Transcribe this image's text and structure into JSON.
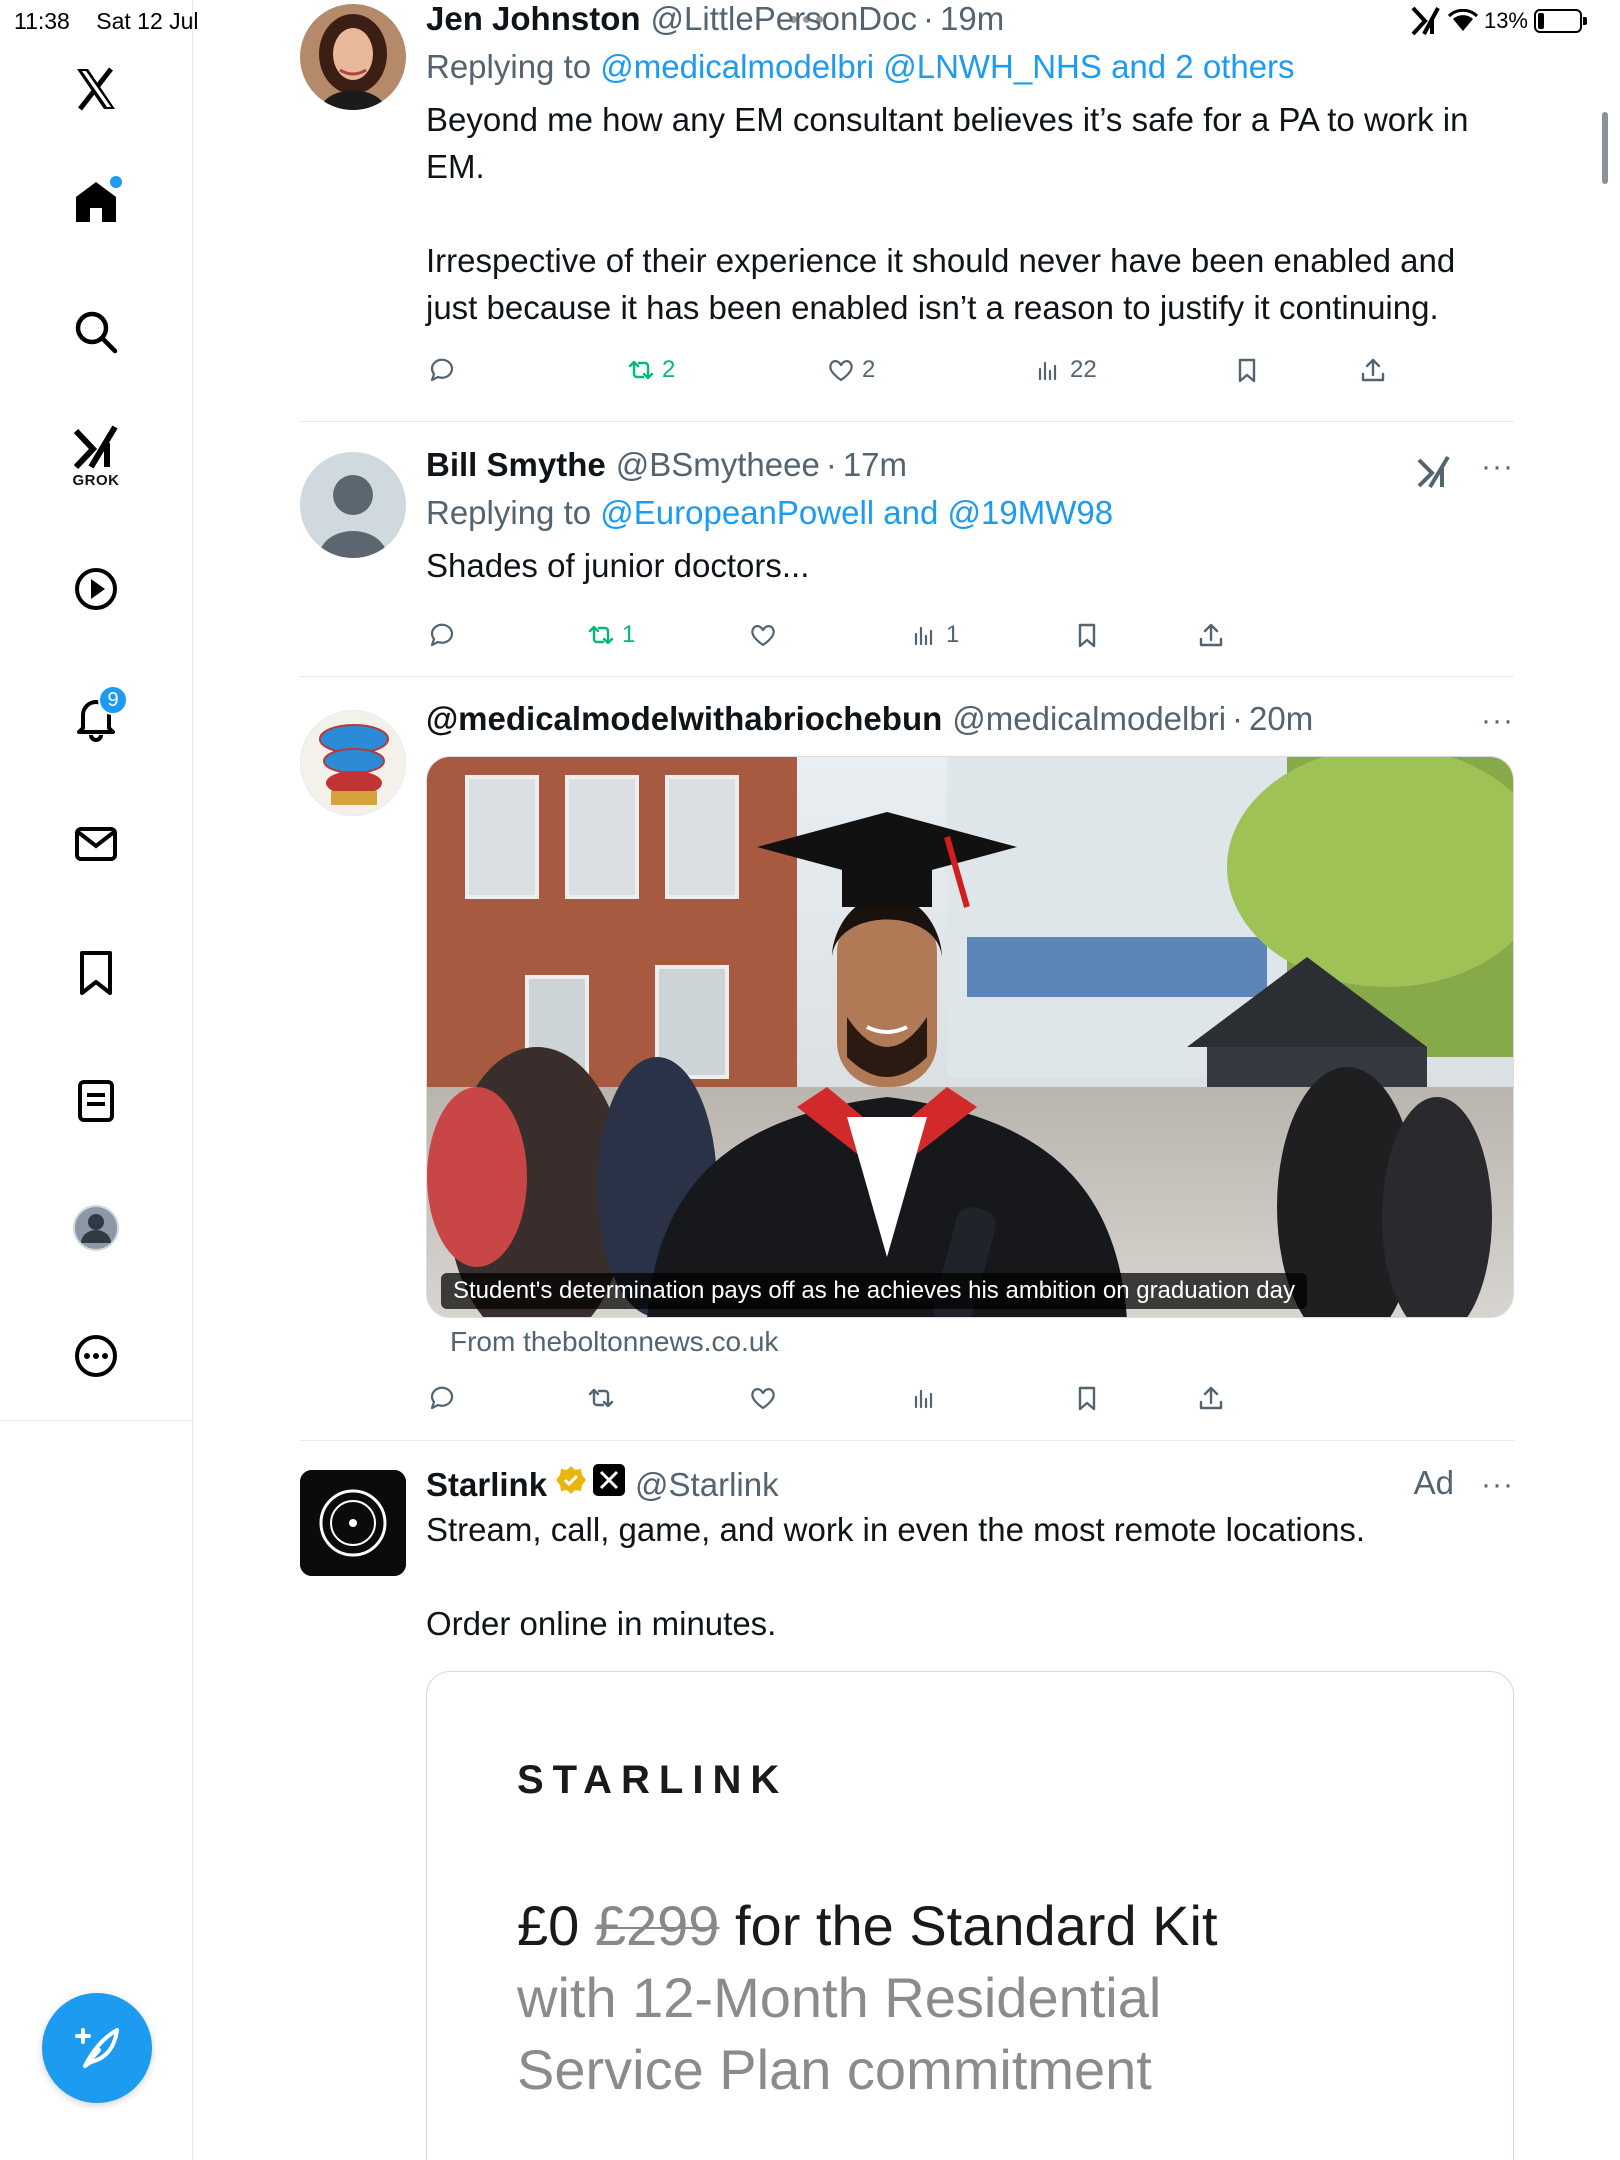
{
  "status_bar": {
    "time": "11:38",
    "date": "Sat 12 Jul",
    "battery_percent": "13%"
  },
  "sidebar": {
    "grok_label": "GROK",
    "notifications_badge": "9"
  },
  "colors": {
    "accent": "#1d9bf0",
    "retweet_green": "#00ba7c",
    "muted_text": "#536471"
  },
  "tweets": [
    {
      "name": "Jen Johnston",
      "handle": "@LittlePersonDoc",
      "time": "19m",
      "reply_prefix": "Replying to",
      "reply_targets": "@medicalmodelbri @LNWH_NHS and 2 others",
      "paragraphs": [
        "Beyond me how any EM consultant believes it’s safe for a PA to work in EM.",
        "Irrespective of their experience it should never have been enabled and just because it has been enabled isn’t a reason to justify it continuing."
      ],
      "retweets": "2",
      "likes": "2",
      "views": "22"
    },
    {
      "name": "Bill Smythe",
      "handle": "@BSmytheee",
      "time": "17m",
      "reply_prefix": "Replying to",
      "reply_targets": "@EuropeanPowell and @19MW98",
      "text": "Shades of junior doctors...",
      "retweets": "1",
      "views": "1"
    },
    {
      "name": "@medicalmodelwithabriochebun",
      "handle": "@medicalmodelbri",
      "time": "20m",
      "media_caption": "Student's determination pays off as he achieves his ambition on graduation day",
      "source": "From theboltonnews.co.uk"
    },
    {
      "name": "Starlink",
      "handle": "@Starlink",
      "ad_label": "Ad",
      "paragraphs": [
        "Stream, call, game, and work in even the most remote locations.",
        "Order online in minutes."
      ],
      "card": {
        "logo": "STARLINK",
        "price_new": "£0",
        "price_old": "£299",
        "headline": "for the Standard Kit",
        "line2": "with 12-Month Residential",
        "line3": "Service Plan commitment"
      }
    }
  ]
}
